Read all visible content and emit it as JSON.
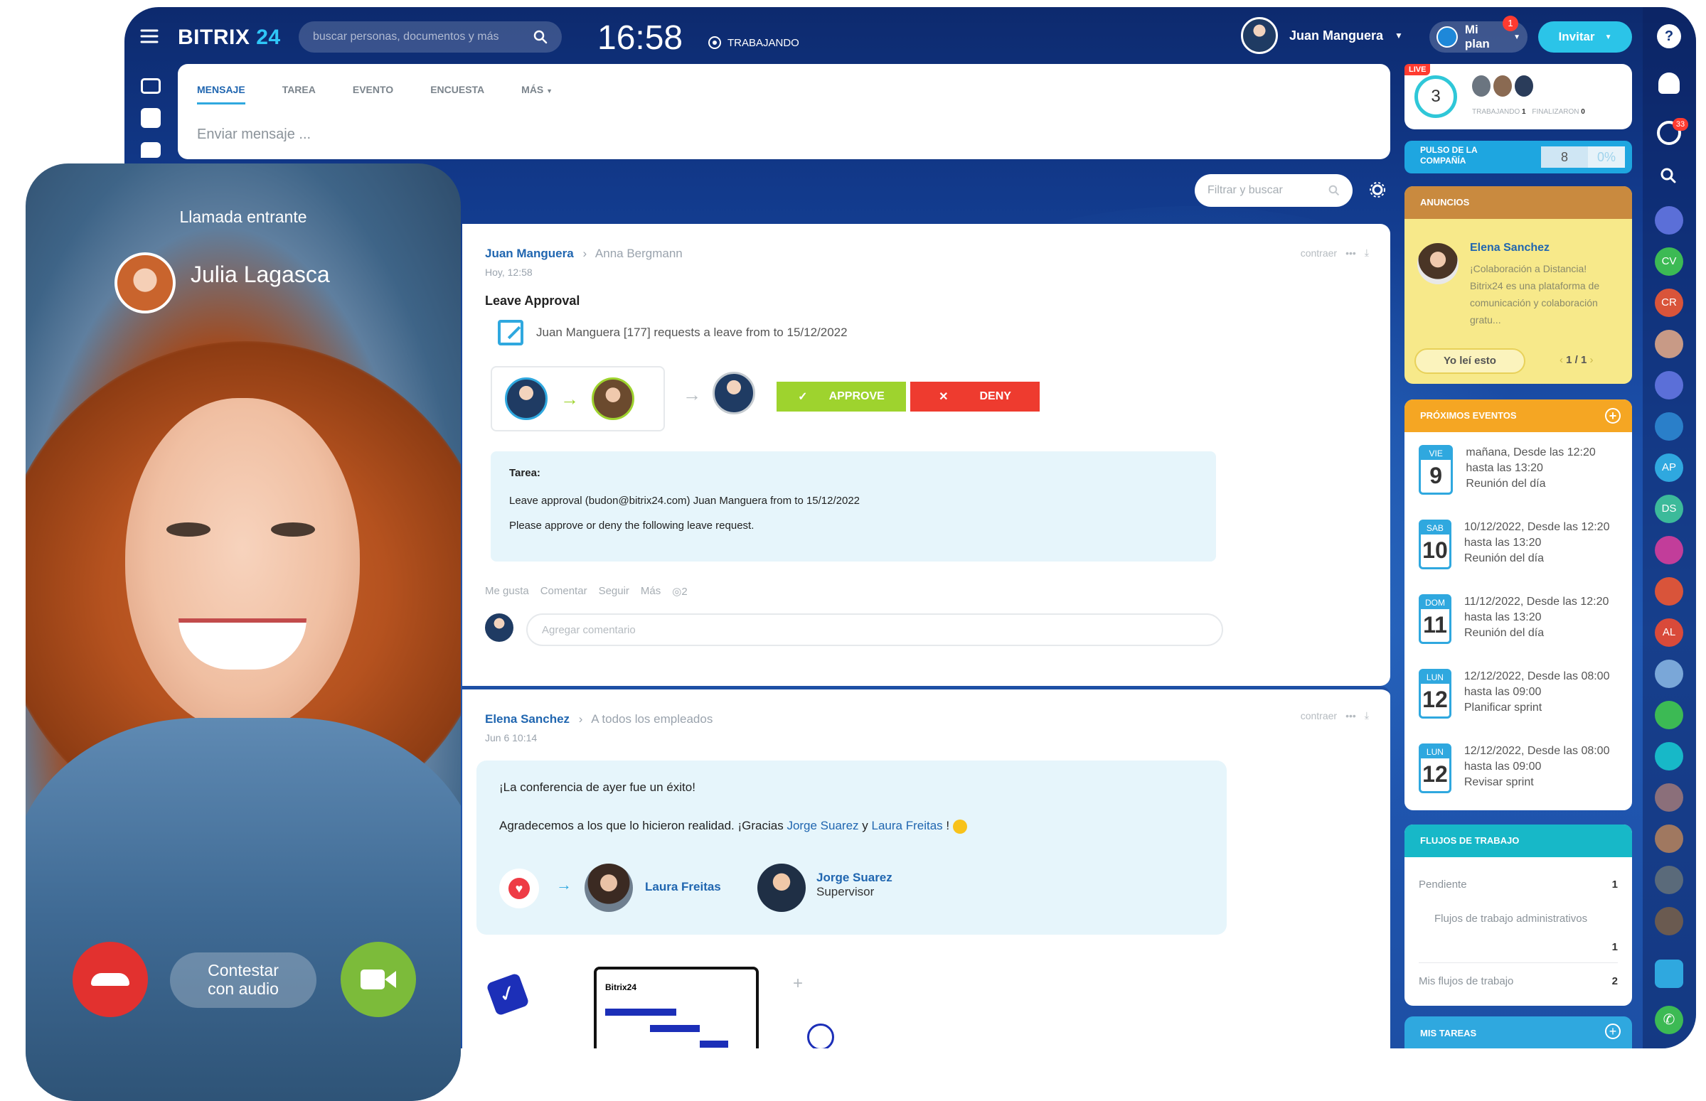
{
  "topbar": {
    "brand_bitrix": "BITRIX",
    "brand_24": "24",
    "search_placeholder": "buscar personas, documentos y más",
    "clock": "16:58",
    "status": "TRABAJANDO",
    "user_name": "Juan Manguera",
    "plan_label": "Mi plan",
    "plan_badge": "1",
    "invite_label": "Invitar"
  },
  "composer": {
    "tabs": [
      "MENSAJE",
      "TAREA",
      "EVENTO",
      "ENCUESTA",
      "MÁS"
    ],
    "placeholder": "Enviar mensaje ..."
  },
  "feed_filter": {
    "placeholder": "Filtrar y buscar"
  },
  "post1": {
    "author": "Juan Manguera",
    "recipient": "Anna Bergmann",
    "time": "Hoy, 12:58",
    "collapse": "contraer",
    "title": "Leave Approval",
    "request_text": "Juan Manguera [177] requests a leave from to 15/12/2022",
    "approve_label": "APPROVE",
    "deny_label": "DENY",
    "task_heading": "Tarea:",
    "task_line1": "Leave approval (budon@bitrix24.com) Juan Manguera from to 15/12/2022",
    "task_line2": "Please approve or deny the following leave request.",
    "actions": [
      "Me gusta",
      "Comentar",
      "Seguir",
      "Más"
    ],
    "views": "2",
    "comment_placeholder": "Agregar comentario"
  },
  "post2": {
    "author": "Elena Sanchez",
    "recipient": "A todos los empleados",
    "time": "Jun 6 10:14",
    "collapse": "contraer",
    "line1": "¡La conferencia de ayer fue un éxito!",
    "line2_prefix": "Agradecemos a los que lo hicieron realidad. ¡Gracias ",
    "mention1": "Jorge Suarez",
    "line2_and": " y ",
    "mention2": "Laura Freitas",
    "line2_suffix": " !",
    "thanks_to": "Laura Freitas",
    "from_name": "Jorge Suarez",
    "from_role": "Supervisor",
    "illustration_label": "Bitrix24"
  },
  "right": {
    "live_badge": "LIVE",
    "live_count": "3",
    "working": "TRABAJANDO",
    "working_count": "1",
    "finished": "FINALIZARON",
    "finished_count": "0",
    "pulse_label": "PULSO DE LA COMPAÑÍA",
    "pulse_value": "8",
    "pulse_percent": "0%",
    "announcements_title": "ANUNCIOS",
    "ann_author": "Elena Sanchez",
    "ann_text": "¡Colaboración a Distancia! Bitrix24 es una plataforma de comunicación y colaboración gratu...",
    "ann_button": "Yo leí esto",
    "ann_pager": "1 / 1",
    "events_title": "PRÓXIMOS EVENTOS",
    "events": [
      {
        "day": "VIE",
        "num": "9",
        "text": "mañana, Desde las 12:20 hasta las 13:20",
        "link": "Reunión del día"
      },
      {
        "day": "SAB",
        "num": "10",
        "text": "10/12/2022, Desde las 12:20 hasta las 13:20",
        "link": "Reunión del día"
      },
      {
        "day": "DOM",
        "num": "11",
        "text": "11/12/2022, Desde las 12:20 hasta las 13:20",
        "link": "Reunión del día"
      },
      {
        "day": "LUN",
        "num": "12",
        "text": "12/12/2022, Desde las 08:00 hasta las 09:00",
        "link": "Planificar sprint"
      },
      {
        "day": "LUN",
        "num": "12",
        "text": "12/12/2022, Desde las 08:00 hasta las 09:00",
        "link": "Revisar sprint"
      }
    ],
    "workflows_title": "FLUJOS DE TRABAJO",
    "wf_pending": "Pendiente",
    "wf_pending_count": "1",
    "wf_admin": "Flujos de trabajo administrativos",
    "wf_admin_count": "1",
    "wf_mine": "Mis flujos de trabajo",
    "wf_mine_count": "2",
    "tasks_title": "MIS TAREAS"
  },
  "rail": {
    "chat_badge": "33",
    "avatars": [
      "CV",
      "CR",
      "AP",
      "DS",
      "AL"
    ]
  },
  "call": {
    "title": "Llamada entrante",
    "caller": "Julia Lagasca",
    "audio_label_1": "Contestar",
    "audio_label_2": "con audio"
  },
  "colors": {
    "window_bg": "#123a8c",
    "approve": "#9ed32e",
    "deny": "#ee3b2f",
    "accent_cyan": "#2fa8df",
    "announcements": "#f7e98a",
    "events_header": "#f5a623",
    "workflows_header": "#17b8c8"
  }
}
